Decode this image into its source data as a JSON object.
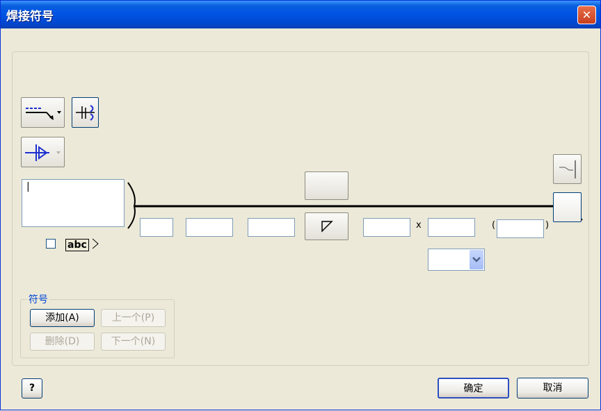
{
  "window": {
    "title": "焊接符号",
    "close_glyph": "✕"
  },
  "arrow": {
    "text_value": "|"
  },
  "abc_tag": "abc",
  "multiply_sign": "x",
  "paren_open": "(",
  "paren_close": ")",
  "symbols_group": {
    "title": "符号",
    "add_label": "添加(A)",
    "prev_label": "上一个(P)",
    "delete_label": "删除(D)",
    "next_label": "下一个(N)"
  },
  "footer": {
    "help_glyph": "?",
    "ok_label": "确定",
    "cancel_label": "取消"
  },
  "colors": {
    "titlebar": "#0055e5",
    "accent": "#003c74",
    "group_label": "#0046d5"
  },
  "icons": {
    "leader": "leader-style-icon",
    "swap": "swap-symbol-icon",
    "arrow_side": "arrow-side-icon",
    "fillet": "fillet-symbol-icon",
    "tail": "tail-icon",
    "field_weld": "field-weld-icon"
  }
}
